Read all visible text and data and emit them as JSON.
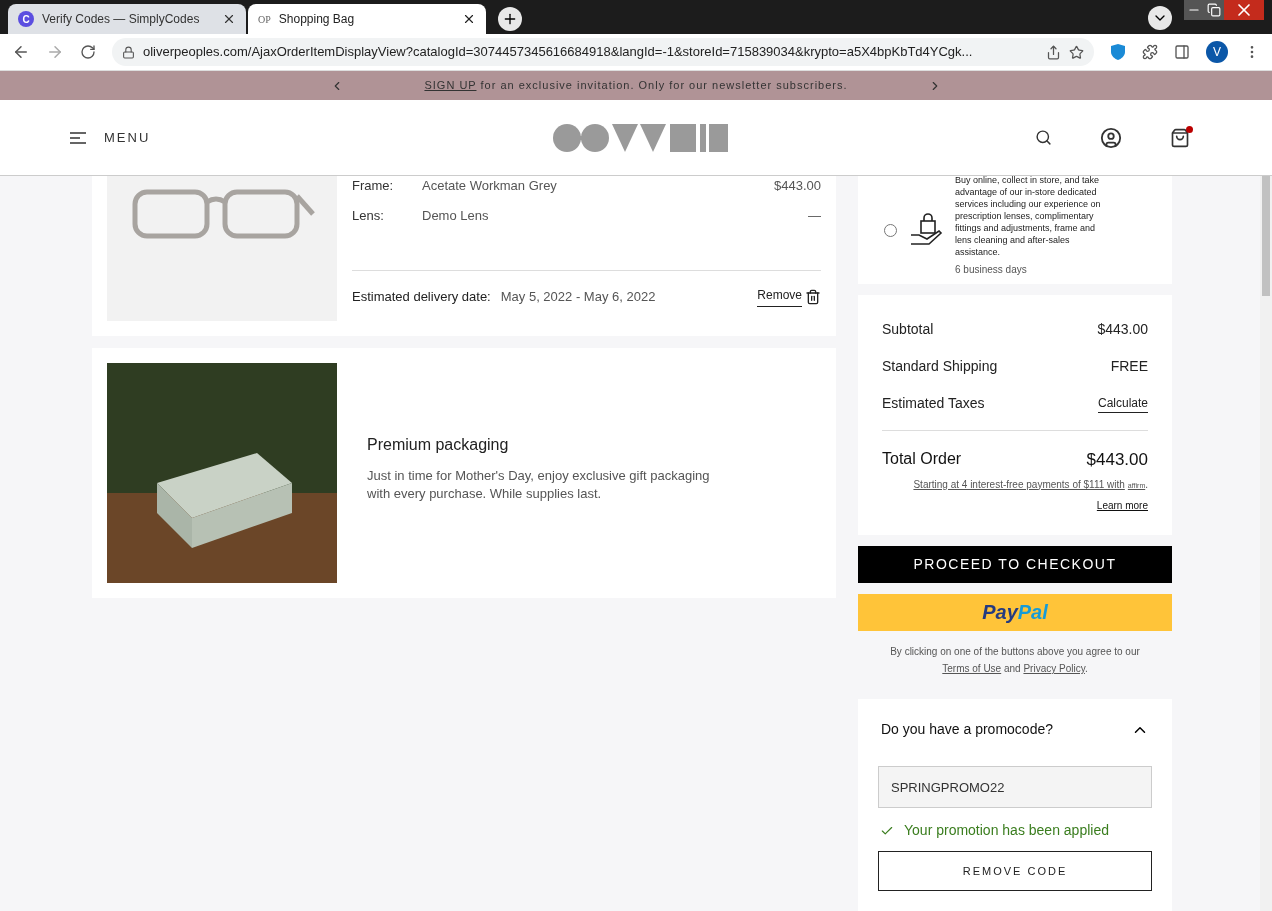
{
  "browser": {
    "tabs": [
      {
        "label": "Verify Codes — SimplyCodes",
        "selected": false,
        "favicon": "C"
      },
      {
        "label": "Shopping Bag",
        "selected": true,
        "favicon": "OP"
      }
    ],
    "url": "oliverpeoples.com/AjaxOrderItemDisplayView?catalogId=3074457345616684918&langId=-1&storeId=715839034&krypto=a5X4bpKbTd4YCgk...",
    "profile": "V"
  },
  "promo_bar": {
    "link": "SIGN UP",
    "text": "for an exclusive invitation. Only for our newsletter subscribers."
  },
  "header": {
    "menu": "MENU",
    "cart_has_items": true
  },
  "items": [
    {
      "kind": "product",
      "details": [
        {
          "label": "Frame:",
          "value": "Acetate Workman Grey",
          "price": "$443.00"
        },
        {
          "label": "Lens:",
          "value": "Demo Lens",
          "price": "—"
        }
      ],
      "delivery_label": "Estimated delivery date:",
      "delivery_value": "May 5, 2022 - May 6, 2022",
      "remove": "Remove"
    },
    {
      "kind": "gift",
      "title": "Premium packaging",
      "text": "Just in time for Mother's Day, enjoy exclusive gift packaging with every purchase. While supplies last."
    }
  ],
  "pickup": {
    "selected": false,
    "text": "Buy online, collect in store, and take advantage of our in-store dedicated services including our experience on prescription lenses, complimentary fittings and adjustments, frame and lens cleaning and after-sales assistance.",
    "time": "6 business days"
  },
  "summary": {
    "rows": [
      {
        "label": "Subtotal",
        "value": "$443.00",
        "kind": "text"
      },
      {
        "label": "Standard Shipping",
        "value": "FREE",
        "kind": "text"
      },
      {
        "label": "Estimated Taxes",
        "value": "Calculate",
        "kind": "link"
      }
    ],
    "total_label": "Total Order",
    "total_value": "$443.00",
    "installments": "Starting at 4 interest-free payments of $111 with",
    "installments_brand": "affirm",
    "installments_end": ".",
    "learn_more": "Learn more"
  },
  "checkout": "PROCEED TO CHECKOUT",
  "paypal": [
    "Pay",
    "Pal"
  ],
  "terms": {
    "before": "By clicking on one of the buttons above you agree to our",
    "terms": "Terms of Use",
    "and": "and",
    "privacy": "Privacy Policy",
    "end": "."
  },
  "promocode": {
    "title": "Do you have a promocode?",
    "expanded": true,
    "value": "SPRINGPROMO22",
    "message": "Your promotion has been applied",
    "remove": "REMOVE CODE"
  }
}
